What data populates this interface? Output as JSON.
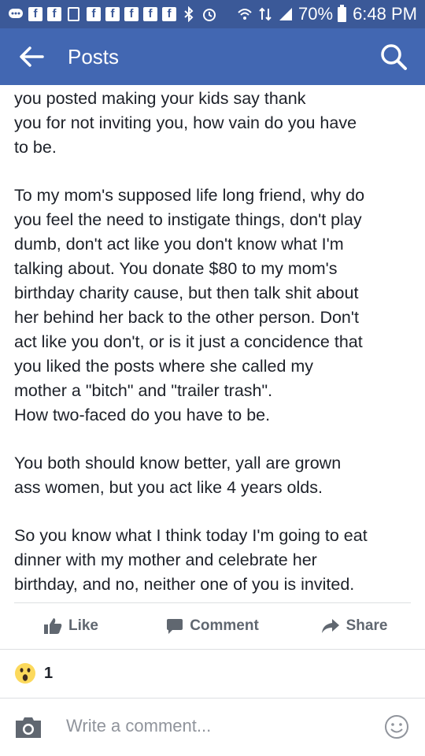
{
  "status_bar": {
    "battery": "70%",
    "time": "6:48 PM",
    "fb_glyph": "f"
  },
  "app_bar": {
    "title": "Posts"
  },
  "post": {
    "paragraphs": [
      "you posted making your kids say thank\nyou for not inviting you, how vain do you have\nto be.",
      "To my mom's supposed life long friend, why do\nyou feel the need to instigate things, don't play\ndumb, don't act like you don't know what I'm\ntalking about. You donate $80 to my mom's\nbirthday charity cause, but then talk shit about\nher behind her back to the other person. Don't\nact like you don't, or is it just a concidence that\nyou liked the posts where she called my\nmother a \"bitch\" and \"trailer trash\".\nHow two-faced do you have to be.",
      "You both should know better, yall are grown\nass women, but you act like 4 years olds.",
      "So you know what I think today I'm going to eat\ndinner with my mother and celebrate her\nbirthday, and no, neither one of you is invited."
    ]
  },
  "actions": {
    "like": "Like",
    "comment": "Comment",
    "share": "Share"
  },
  "reactions": {
    "wow_count": "1"
  },
  "comment_box": {
    "placeholder": "Write a comment..."
  },
  "colors": {
    "status_bar": "#3b5998",
    "app_bar": "#4267b2",
    "text": "#1d2129",
    "action_text": "#606770"
  }
}
